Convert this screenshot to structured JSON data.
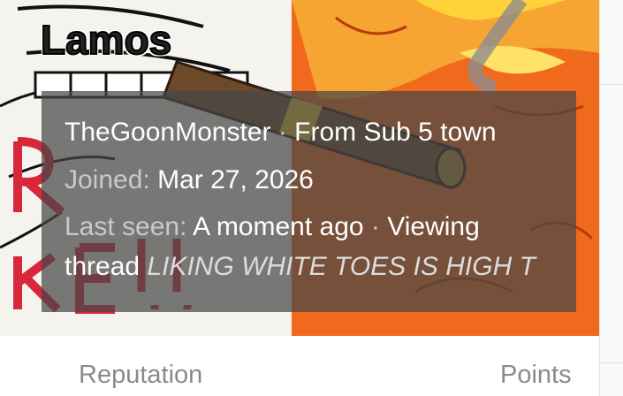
{
  "profile": {
    "username": "Lamos",
    "user_link": "TheGoonMonster",
    "separator": "·",
    "location": "From Sub 5 town",
    "joined_label": "Joined:",
    "joined_date": "Mar 27, 2026",
    "last_seen_label": "Last seen:",
    "last_seen_value": "A moment ago",
    "activity_prefix": "Viewing",
    "activity_word": "thread",
    "thread_title": "LIKING WHITE TOES IS HIGH T"
  },
  "stats": {
    "reputation_label": "Reputation",
    "points_label": "Points"
  },
  "colors": {
    "panel_overlay": "#464646",
    "text_white": "#ffffff",
    "text_muted": "#c9c9c9",
    "stat_label": "#8a8a8a",
    "banner_red": "#d8263b",
    "banner_orange": "#f06a1e"
  }
}
